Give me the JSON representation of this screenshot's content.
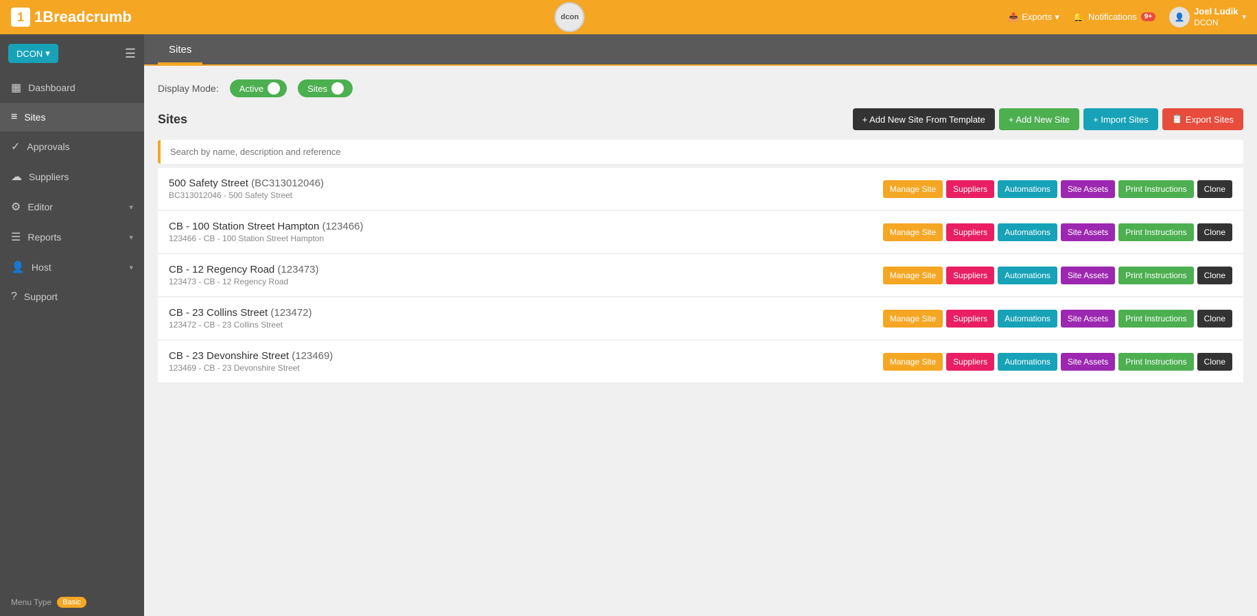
{
  "app": {
    "name": "1Breadcrumb",
    "logo_text": "1Breadcrumb"
  },
  "topnav": {
    "exports_label": "Exports",
    "notifications_label": "Notifications",
    "notifications_badge": "9+",
    "user_name": "Joel Ludik",
    "user_org": "DCON",
    "logo_text": "dcon"
  },
  "sidebar": {
    "org_button": "DCON",
    "items": [
      {
        "id": "dashboard",
        "label": "Dashboard",
        "icon": "▦",
        "has_arrow": false
      },
      {
        "id": "sites",
        "label": "Sites",
        "icon": "≡",
        "has_arrow": false,
        "active": true
      },
      {
        "id": "approvals",
        "label": "Approvals",
        "icon": "✓",
        "has_arrow": false
      },
      {
        "id": "suppliers",
        "label": "Suppliers",
        "icon": "☁",
        "has_arrow": false
      },
      {
        "id": "editor",
        "label": "Editor",
        "icon": "⚙",
        "has_arrow": true
      },
      {
        "id": "reports",
        "label": "Reports",
        "icon": "☰",
        "has_arrow": true
      },
      {
        "id": "host",
        "label": "Host",
        "icon": "👤",
        "has_arrow": true
      },
      {
        "id": "support",
        "label": "Support",
        "icon": "?",
        "has_arrow": false
      }
    ],
    "menu_type_label": "Menu Type",
    "menu_type_value": "Basic"
  },
  "page": {
    "title": "Sites",
    "tab_label": "Sites"
  },
  "display_mode": {
    "label": "Display Mode:",
    "active_label": "Active",
    "sites_label": "Sites"
  },
  "sites_section": {
    "title": "Sites",
    "add_template_btn": "+ Add New Site From Template",
    "add_new_btn": "+ Add New Site",
    "import_btn": "+ Import Sites",
    "export_btn": "Export Sites",
    "search_placeholder": "Search by name, description and reference"
  },
  "site_rows": [
    {
      "name": "500 Safety Street",
      "id_code": "BC313012046",
      "sub": "BC313012046 - 500 Safety Street",
      "actions": [
        "Manage Site",
        "Suppliers",
        "Automations",
        "Site Assets",
        "Print Instructions",
        "Clone"
      ]
    },
    {
      "name": "CB - 100 Station Street Hampton",
      "id_code": "123466",
      "sub": "123466 - CB - 100 Station Street Hampton",
      "actions": [
        "Manage Site",
        "Suppliers",
        "Automations",
        "Site Assets",
        "Print Instructions",
        "Clone"
      ]
    },
    {
      "name": "CB - 12 Regency Road",
      "id_code": "123473",
      "sub": "123473 - CB - 12 Regency Road",
      "actions": [
        "Manage Site",
        "Suppliers",
        "Automations",
        "Site Assets",
        "Print Instructions",
        "Clone"
      ]
    },
    {
      "name": "CB - 23 Collins Street",
      "id_code": "123472",
      "sub": "123472 - CB - 23 Collins Street",
      "actions": [
        "Manage Site",
        "Suppliers",
        "Automations",
        "Site Assets",
        "Print Instructions",
        "Clone"
      ]
    },
    {
      "name": "CB - 23 Devonshire Street",
      "id_code": "123469",
      "sub": "123469 - CB - 23 Devonshire Street",
      "actions": [
        "Manage Site",
        "Suppliers",
        "Automations",
        "Site Assets",
        "Print Instructions",
        "Clone"
      ]
    }
  ],
  "action_colors": {
    "Manage Site": "btn-orange",
    "Suppliers": "btn-pink",
    "Automations": "btn-teal",
    "Site Assets": "btn-purple",
    "Print Instructions": "btn-success",
    "Clone": "btn-dark-sm"
  }
}
